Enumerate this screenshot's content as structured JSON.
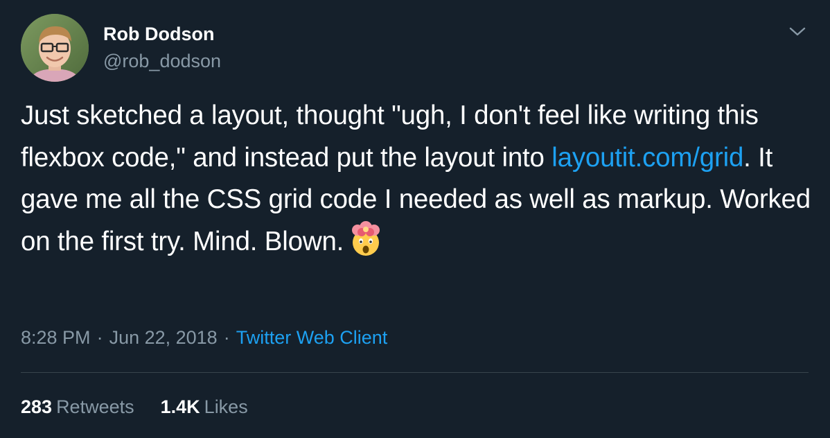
{
  "user": {
    "name": "Rob Dodson",
    "handle": "@rob_dodson"
  },
  "tweet": {
    "text_part1": "Just sketched a layout, thought \"ugh, I don't feel like writing this flexbox code,\" and instead put the layout into ",
    "link": "layoutit.com/grid",
    "text_part2": ". It gave me all the CSS grid code I needed as well as markup. Worked on the first try. Mind. Blown.",
    "emoji_icon": "exploding-head-icon"
  },
  "meta": {
    "time": "8:28 PM",
    "separator": "·",
    "date": "Jun 22, 2018",
    "client": "Twitter Web Client"
  },
  "stats": {
    "retweets_count": "283",
    "retweets_label": "Retweets",
    "likes_count": "1.4K",
    "likes_label": "Likes"
  },
  "colors": {
    "background": "#15202b",
    "text": "#ffffff",
    "secondary": "#8899a6",
    "link": "#1da1f2",
    "divider": "#38444d"
  }
}
